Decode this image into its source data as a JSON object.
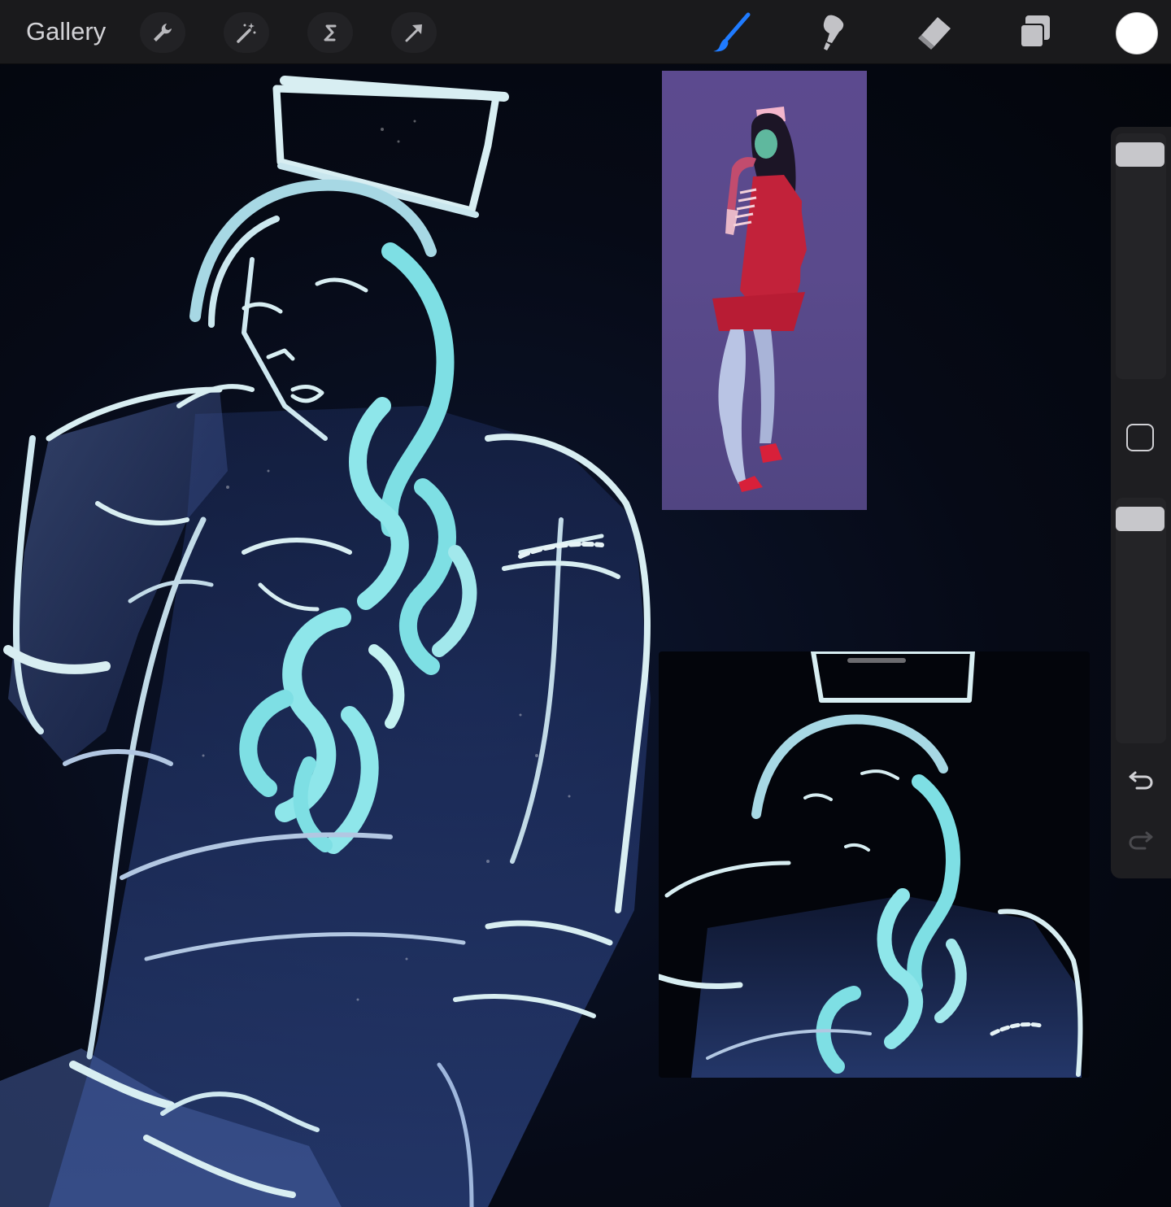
{
  "toolbar": {
    "gallery_label": "Gallery",
    "left_tools": [
      "wrench-icon",
      "magic-wand-icon",
      "selection-s-icon",
      "transform-arrow-icon"
    ],
    "right_tools": [
      "brush-icon",
      "smudge-icon",
      "eraser-icon",
      "layers-icon"
    ],
    "active_tool": "brush-icon",
    "current_color": "#ffffff",
    "active_tool_color": "#1f7bff"
  },
  "sidebar": {
    "brush_size_level": 0.98,
    "opacity_level": 0.98,
    "undo_icon": "undo-arrow-icon",
    "redo_icon": "redo-arrow-icon",
    "modify_icon": "modify-square-icon"
  },
  "canvas": {
    "background": "#05080f",
    "stroke_color_light": "#d8f4f4",
    "stroke_color_cyan": "#7ee0e6",
    "stroke_color_blue": "#4a6fc4"
  }
}
